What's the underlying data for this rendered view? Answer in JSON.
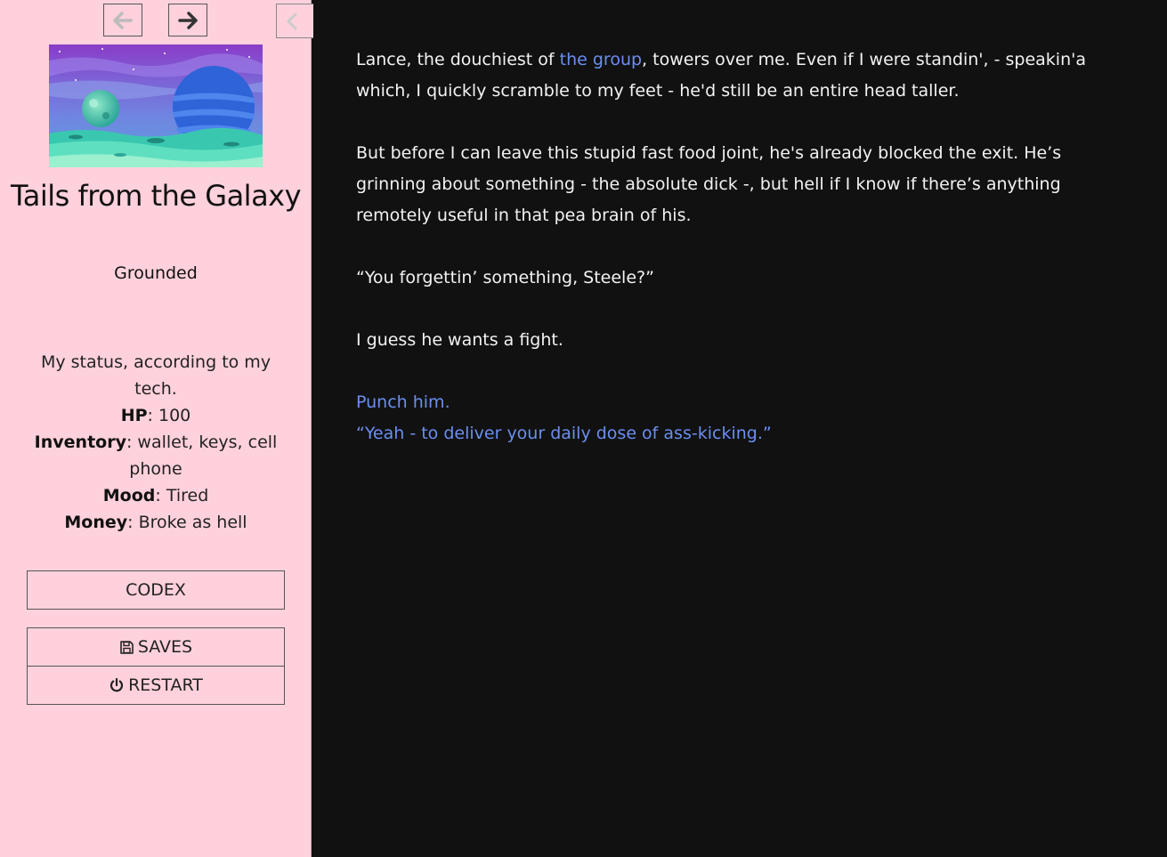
{
  "sidebar": {
    "title": "Tails from the Galaxy",
    "subtitle": "Grounded",
    "status": {
      "intro": "My status, according to my tech.",
      "hp_label": "HP",
      "hp_value": "100",
      "inventory_label": "Inventory",
      "inventory_value": "wallet, keys, cell phone",
      "mood_label": "Mood",
      "mood_value": "Tired",
      "money_label": "Money",
      "money_value": "Broke as hell"
    },
    "menu": {
      "codex": "CODEX",
      "saves": "SAVES",
      "restart": "RESTART"
    }
  },
  "passage": {
    "p1_before": "Lance, the douchiest of ",
    "p1_link": "the group",
    "p1_after": ", towers over me. Even if I were standin', - speakin'a which, I quickly scramble to my feet - he'd still be an entire head taller.",
    "p2": "But before I can leave this stupid fast food joint, he's already blocked the exit. He’s grinning about something - the absolute dick -, but hell if I know if there’s anything remotely useful in that pea brain of his.",
    "p3": "“You forgettin’ something, Steele?”",
    "p4": "I guess he wants a fight.",
    "choices": [
      "Punch him.",
      "“Yeah - to deliver your daily dose of ass-kicking.”"
    ]
  },
  "icons": {
    "back": "arrow-left-icon",
    "forward": "arrow-right-icon",
    "collapse": "chevron-left-icon",
    "saves": "floppy-disk-icon",
    "restart": "power-icon"
  },
  "colors": {
    "sidebar_bg": "#ffd1dc",
    "main_bg": "#111111",
    "link": "#6b8ff0"
  }
}
